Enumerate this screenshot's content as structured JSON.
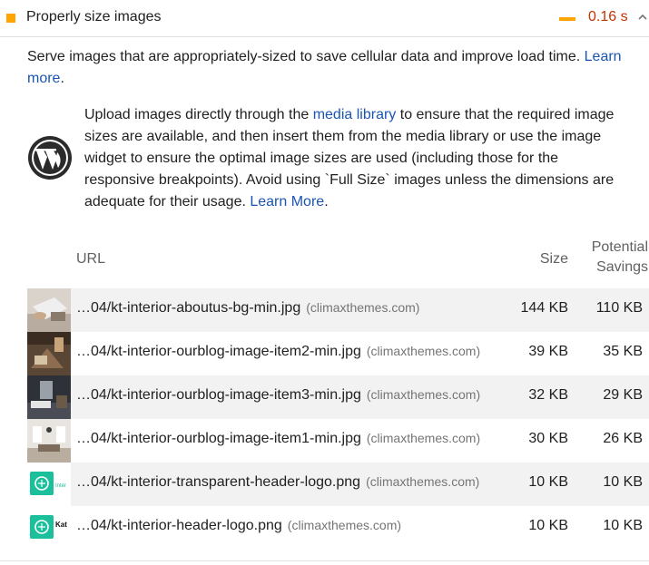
{
  "audit": {
    "title": "Properly size images",
    "value": "0.16 s",
    "status_color": "#ffa400",
    "value_color": "#c33300",
    "icon": "chevron-up-icon"
  },
  "description": {
    "text": "Serve images that are appropriately-sized to save cellular data and improve load time. ",
    "link": "Learn more",
    "end": "."
  },
  "wp_note": {
    "icon": "wordpress-logo-icon",
    "text1": "Upload images directly through the ",
    "link1": "media library",
    "text2": " to ensure that the required image sizes are available, and then insert them from the media library or use the image widget to ensure the optimal image sizes are used (including those for the responsive breakpoints). Avoid using `Full Size` images unless the dimensions are adequate for their usage. ",
    "link2": "Learn More",
    "end": "."
  },
  "table": {
    "headers": {
      "url": "URL",
      "size": "Size",
      "savings_line1": "Potential",
      "savings_line2": "Savings"
    },
    "rows": [
      {
        "url": "…04/kt-interior-aboutus-bg-min.jpg",
        "host": "(climaxthemes.com)",
        "size": "144 KB",
        "savings": "110 KB",
        "thumb": "photo-thumbnail"
      },
      {
        "url": "…04/kt-interior-ourblog-image-item2-min.jpg",
        "host": "(climaxthemes.com)",
        "size": "39 KB",
        "savings": "35 KB",
        "thumb": "photo-thumbnail"
      },
      {
        "url": "…04/kt-interior-ourblog-image-item3-min.jpg",
        "host": "(climaxthemes.com)",
        "size": "32 KB",
        "savings": "29 KB",
        "thumb": "photo-thumbnail"
      },
      {
        "url": "…04/kt-interior-ourblog-image-item1-min.jpg",
        "host": "(climaxthemes.com)",
        "size": "30 KB",
        "savings": "26 KB",
        "thumb": "photo-thumbnail"
      },
      {
        "url": "…04/kt-interior-transparent-header-logo.png",
        "host": "(climaxthemes.com)",
        "size": "10 KB",
        "savings": "10 KB",
        "thumb": "logo-thumbnail",
        "logo_text": "Inter"
      },
      {
        "url": "…04/kt-interior-header-logo.png",
        "host": "(climaxthemes.com)",
        "size": "10 KB",
        "savings": "10 KB",
        "thumb": "logo-thumbnail",
        "logo_text": "Kat"
      }
    ]
  }
}
